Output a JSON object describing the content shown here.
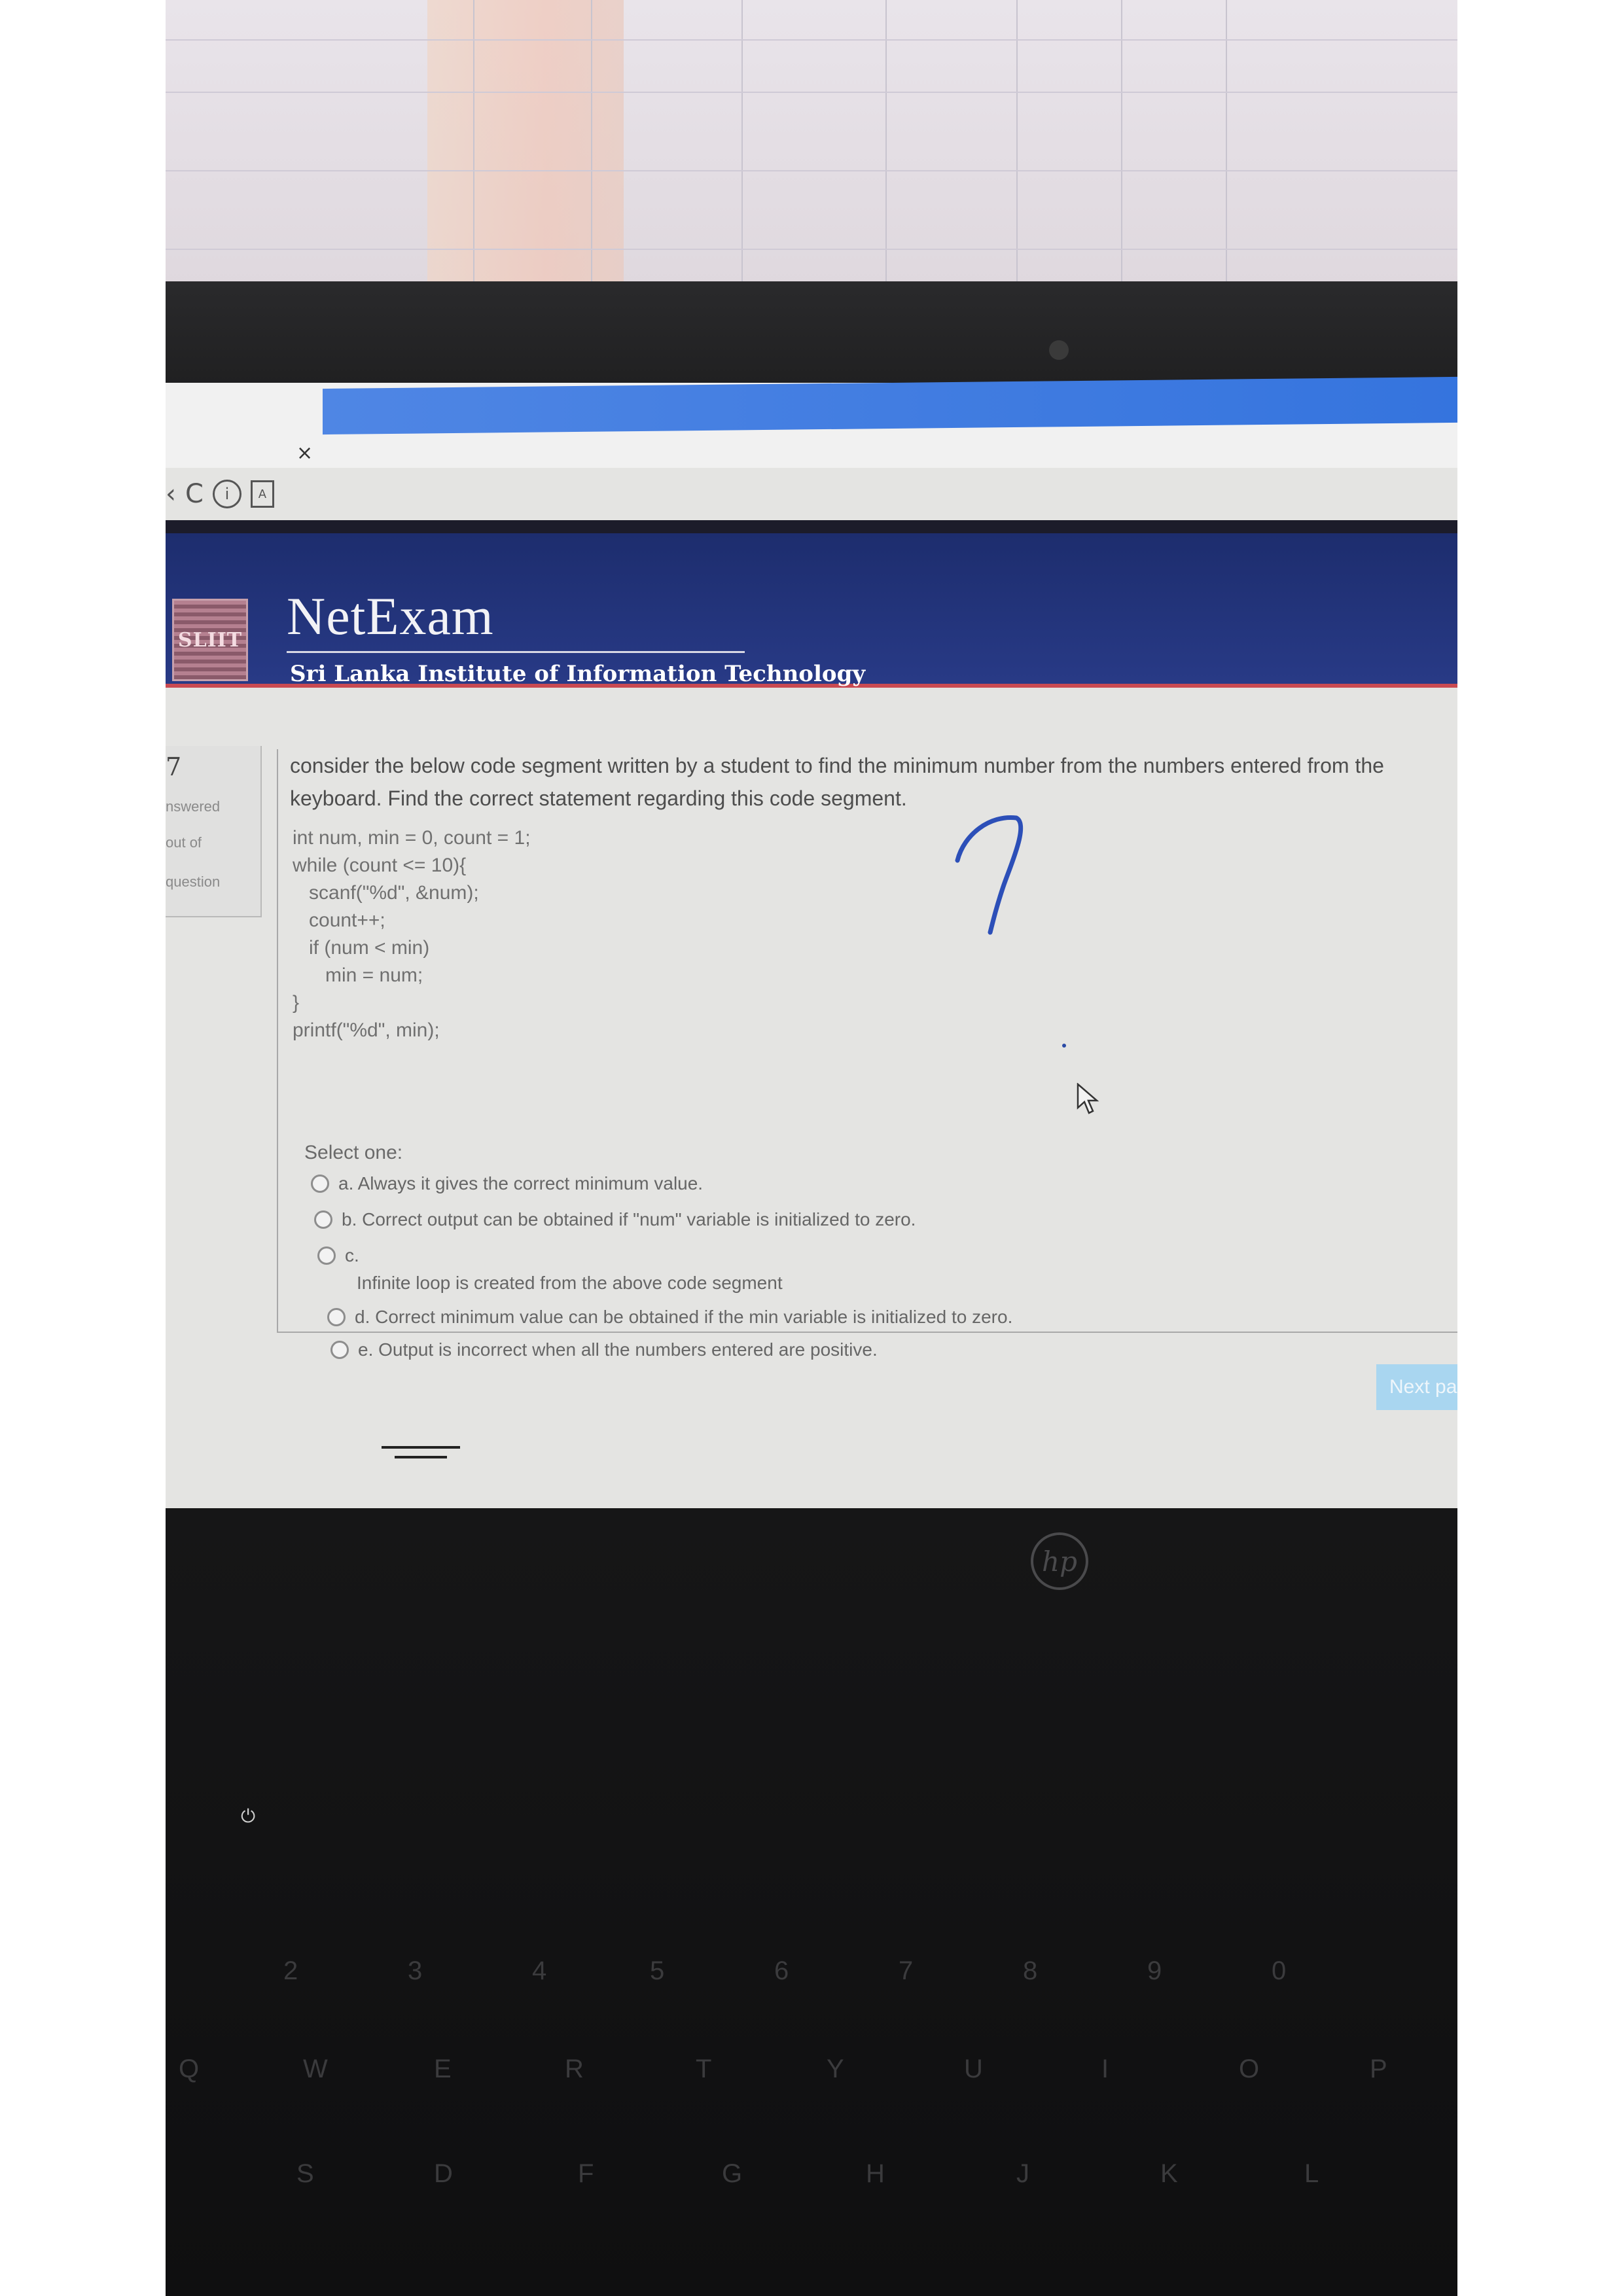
{
  "header": {
    "brand_title": "NetExam",
    "brand_subtitle": "Sri Lanka Institute of Information Technology",
    "logo_text": "SLIIT"
  },
  "browser": {
    "tab_close": "×",
    "back": "‹",
    "reload": "C",
    "info": "i",
    "page_icon": "A"
  },
  "info_panel": {
    "number": "7",
    "answered": "nswered",
    "out_of": "out of",
    "question": "question"
  },
  "question": {
    "text": "consider the below code segment written by a student to find the minimum number from the numbers entered from the keyboard. Find the correct statement regarding this code segment.",
    "code": [
      "int num, min = 0, count = 1;",
      "while (count <= 10){",
      "   scanf(\"%d\", &num);",
      "   count++;",
      "   if (num < min)",
      "      min = num;",
      "}",
      "printf(\"%d\", min);"
    ],
    "select_label": "Select one:",
    "options": [
      "a. Always it gives the correct minimum value.",
      "b. Correct output can be obtained if \"num\" variable is initialized to zero.",
      "c.",
      "Infinite loop is created from the above code segment",
      "d. Correct minimum value can be obtained if the min variable is initialized to zero.",
      "e. Output is incorrect when all the numbers entered are positive."
    ],
    "handwritten_mark": "?"
  },
  "next_button": "Next pa",
  "laptop": {
    "brand": "hp",
    "keys_row1": [
      "2",
      "3",
      "4",
      "5",
      "6",
      "7",
      "8",
      "9",
      "0"
    ],
    "keys_row2": [
      "Q",
      "W",
      "E",
      "R",
      "T",
      "Y",
      "U",
      "I",
      "O",
      "P"
    ],
    "keys_row3": [
      "S",
      "D",
      "F",
      "G",
      "H",
      "J",
      "K",
      "L"
    ]
  }
}
